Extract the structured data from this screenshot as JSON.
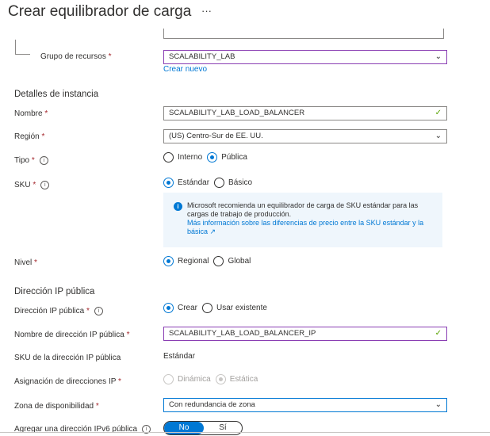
{
  "header": {
    "title": "Crear equilibrador de carga",
    "more": "···"
  },
  "resource_group": {
    "label": "Grupo de recursos",
    "value": "SCALABILITY_LAB",
    "create_new": "Crear nuevo"
  },
  "instance": {
    "heading": "Detalles de instancia",
    "name": {
      "label": "Nombre",
      "value": "SCALABILITY_LAB_LOAD_BALANCER"
    },
    "region": {
      "label": "Región",
      "value": "(US) Centro-Sur de EE. UU."
    },
    "type": {
      "label": "Tipo",
      "options": [
        "Interno",
        "Pública"
      ],
      "selected": "Pública"
    },
    "sku": {
      "label": "SKU",
      "options": [
        "Estándar",
        "Básico"
      ],
      "selected": "Estándar"
    },
    "info": {
      "text": "Microsoft recomienda un equilibrador de carga de SKU estándar para las cargas de trabajo de producción.",
      "link": "Más información sobre las diferencias de precio entre la SKU estándar y la básica"
    },
    "tier": {
      "label": "Nivel",
      "options": [
        "Regional",
        "Global"
      ],
      "selected": "Regional"
    }
  },
  "public_ip": {
    "heading": "Dirección IP pública",
    "ip": {
      "label": "Dirección IP pública",
      "options": [
        "Crear",
        "Usar existente"
      ],
      "selected": "Crear"
    },
    "name": {
      "label": "Nombre de dirección IP pública",
      "value": "SCALABILITY_LAB_LOAD_BALANCER_IP"
    },
    "sku": {
      "label": "SKU de la dirección IP pública",
      "value": "Estándar"
    },
    "assignment": {
      "label": "Asignación de direcciones IP",
      "options": [
        "Dinámica",
        "Estática"
      ],
      "selected": "Estática"
    },
    "zone": {
      "label": "Zona de disponibilidad",
      "value": "Con redundancia de zona"
    },
    "ipv6": {
      "label": "Agregar una dirección IPv6 pública",
      "options": [
        "No",
        "Sí"
      ],
      "selected": "No"
    }
  },
  "colors": {
    "accent": "#0078d4",
    "focus": "#8a3eb3",
    "required": "#a4262c"
  }
}
